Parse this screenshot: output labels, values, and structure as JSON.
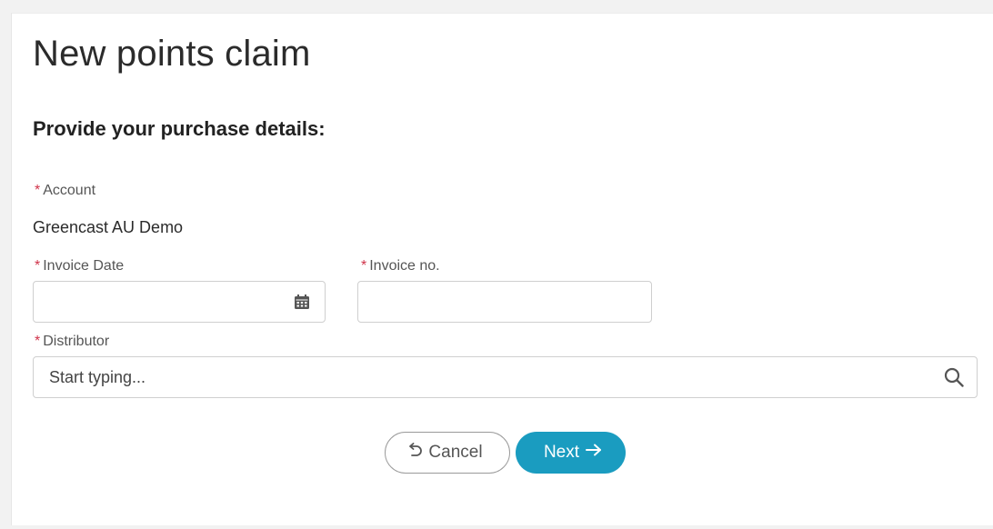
{
  "page": {
    "title": "New points claim",
    "section_heading": "Provide your purchase details:"
  },
  "form": {
    "required_marker": "*",
    "account": {
      "label": "Account",
      "value": "Greencast AU Demo"
    },
    "invoice_date": {
      "label": "Invoice Date",
      "value": "",
      "icon": "calendar-icon"
    },
    "invoice_no": {
      "label": "Invoice no.",
      "value": ""
    },
    "distributor": {
      "label": "Distributor",
      "placeholder": "Start typing...",
      "icon": "search-icon"
    }
  },
  "actions": {
    "cancel_label": "Cancel",
    "next_label": "Next"
  },
  "colors": {
    "accent": "#1a9cc0",
    "required": "#d0334a"
  }
}
